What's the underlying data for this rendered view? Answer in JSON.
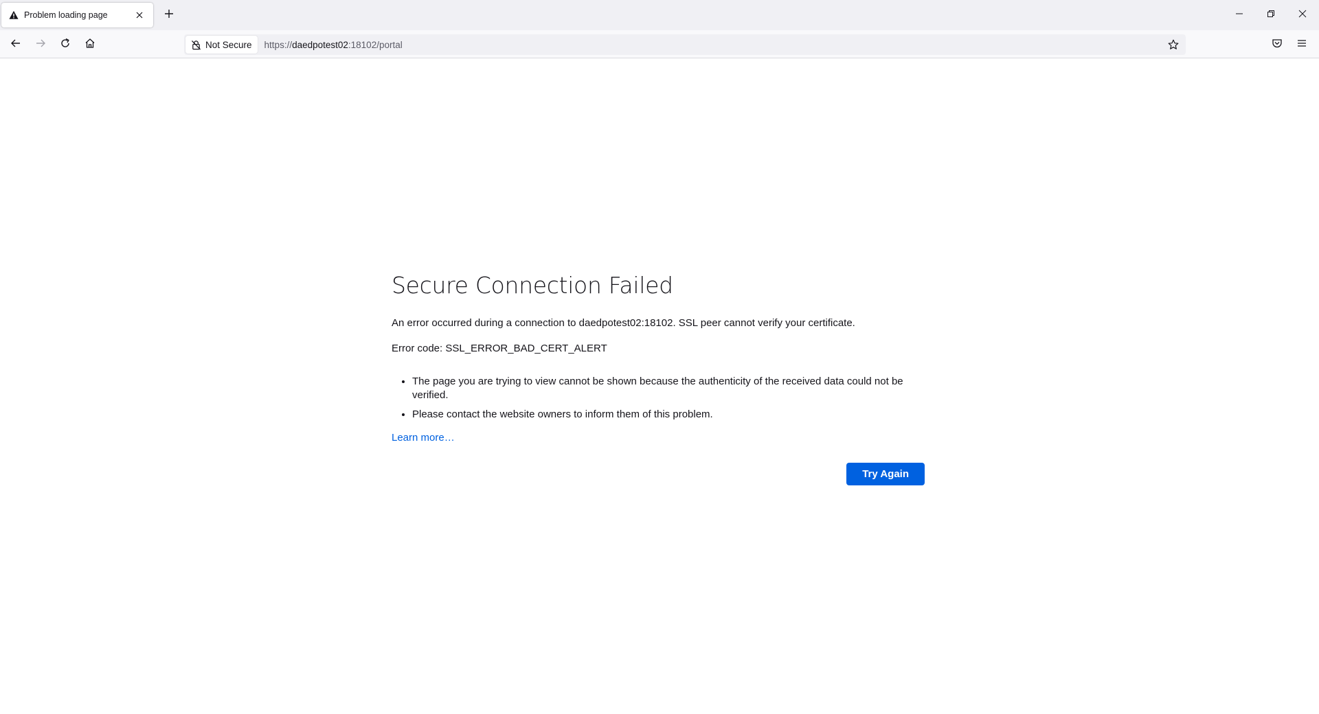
{
  "browser": {
    "tab": {
      "title": "Problem loading page",
      "icon": "warning-icon"
    },
    "new_tab_icon": "plus-icon",
    "window_controls": [
      "minimize-icon",
      "restore-icon",
      "close-icon"
    ],
    "nav": {
      "back_icon": "arrow-left-icon",
      "forward_icon": "arrow-right-icon",
      "reload_icon": "reload-icon",
      "home_icon": "home-icon"
    },
    "urlbar": {
      "security_label": "Not Secure",
      "url_scheme": "https://",
      "url_host": "daedpotest02",
      "url_rest": ":18102/portal"
    },
    "toolbar_icons": [
      "pocket-icon",
      "hamburger-menu-icon"
    ]
  },
  "error_page": {
    "title": "Secure Connection Failed",
    "description": "An error occurred during a connection to daedpotest02:18102. SSL peer cannot verify your certificate.",
    "error_code": "Error code: SSL_ERROR_BAD_CERT_ALERT",
    "bullets": [
      "The page you are trying to view cannot be shown because the authenticity of the received data could not be verified.",
      "Please contact the website owners to inform them of this problem."
    ],
    "learn_more": "Learn more…",
    "try_again": "Try Again"
  },
  "colors": {
    "accent": "#0061e0",
    "tabstrip_bg": "#f0f0f4",
    "navbar_bg": "#f9f9fb",
    "text": "#15141a"
  }
}
